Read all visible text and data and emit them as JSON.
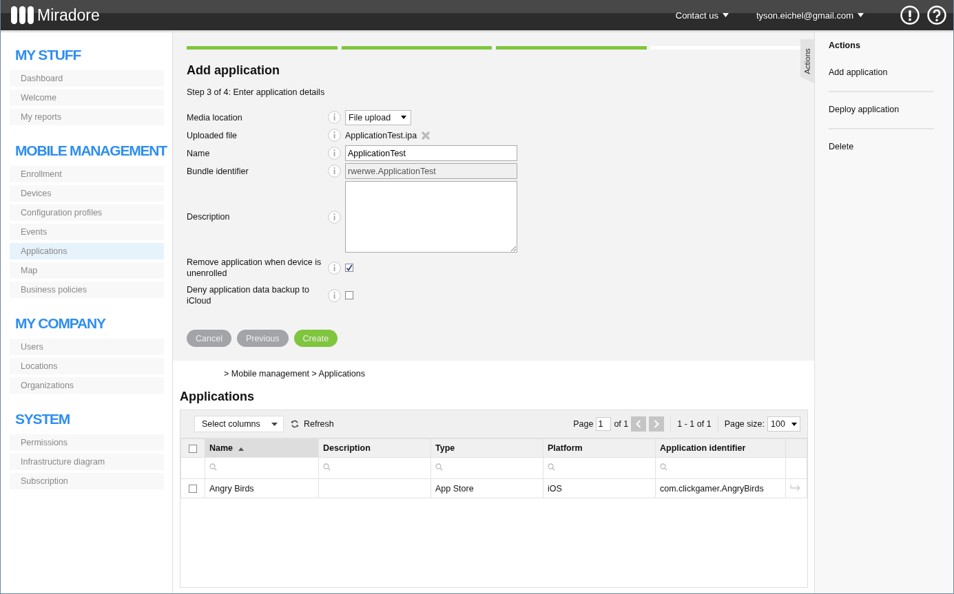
{
  "header": {
    "logo": "Miradore",
    "menus": [
      {
        "label": "Contact us"
      },
      {
        "label": "tyson.eichel@gmail.com"
      }
    ]
  },
  "sidebar": {
    "sections": [
      {
        "title": "MY STUFF",
        "items": [
          {
            "label": "Dashboard",
            "selected": false
          },
          {
            "label": "Welcome",
            "selected": false
          },
          {
            "label": "My reports",
            "selected": false
          }
        ]
      },
      {
        "title": "MOBILE MANAGEMENT",
        "items": [
          {
            "label": "Enrollment",
            "selected": false
          },
          {
            "label": "Devices",
            "selected": false
          },
          {
            "label": "Configuration profiles",
            "selected": false
          },
          {
            "label": "Events",
            "selected": false
          },
          {
            "label": "Applications",
            "selected": true
          },
          {
            "label": "Map",
            "selected": false
          },
          {
            "label": "Business policies",
            "selected": false
          }
        ]
      },
      {
        "title": "MY COMPANY",
        "items": [
          {
            "label": "Users",
            "selected": false
          },
          {
            "label": "Locations",
            "selected": false
          },
          {
            "label": "Organizations",
            "selected": false
          }
        ]
      },
      {
        "title": "SYSTEM",
        "items": [
          {
            "label": "Permissions",
            "selected": false
          },
          {
            "label": "Infrastructure diagram",
            "selected": false
          },
          {
            "label": "Subscription",
            "selected": false
          }
        ]
      }
    ]
  },
  "wizard": {
    "steps": [
      {
        "done": true
      },
      {
        "done": true
      },
      {
        "done": true
      },
      {
        "done": false
      }
    ],
    "title": "Add application",
    "step_text": "Step 3 of 4: Enter application details",
    "fields": [
      {
        "kind": "select",
        "label": "Media location",
        "value": "File upload"
      },
      {
        "kind": "file",
        "label": "Uploaded file",
        "value": "ApplicationTest.ipa"
      },
      {
        "kind": "text",
        "label": "Name",
        "value": "ApplicationTest"
      },
      {
        "kind": "readonly",
        "label": "Bundle identifier",
        "value": "rwerwe.ApplicationTest"
      },
      {
        "kind": "textarea",
        "label": "Description"
      },
      {
        "kind": "checkbox",
        "label": "Remove application when device is unenrolled",
        "checked": true
      },
      {
        "kind": "checkbox",
        "label": "Deny application data backup to iCloud",
        "checked": false
      }
    ],
    "buttons": [
      {
        "label": "Cancel",
        "primary": false
      },
      {
        "label": "Previous",
        "primary": false
      },
      {
        "label": "Create",
        "primary": true
      }
    ]
  },
  "actions_tab": "Actions",
  "actions": {
    "title": "Actions",
    "items": [
      "Add application",
      "Deploy application",
      "Delete"
    ]
  },
  "breadcrumb": "> Mobile management > Applications",
  "list": {
    "title": "Applications",
    "select_columns": "Select columns",
    "refresh": "Refresh",
    "page_label": "Page",
    "page": "1",
    "page_of": "of 1",
    "range": "1 - 1 of 1",
    "page_size_label": "Page size:",
    "page_size": "100",
    "select_all_checked": false,
    "columns": [
      {
        "label": "Name",
        "sorted": true
      },
      {
        "label": "Description",
        "sorted": false
      },
      {
        "label": "Type",
        "sorted": false
      },
      {
        "label": "Platform",
        "sorted": false
      },
      {
        "label": "Application identifier",
        "sorted": false
      }
    ],
    "rows": [
      {
        "checked": false,
        "cells": [
          "Angry Birds",
          "",
          "App Store",
          "iOS",
          "com.clickgamer.AngryBirds"
        ]
      }
    ]
  }
}
